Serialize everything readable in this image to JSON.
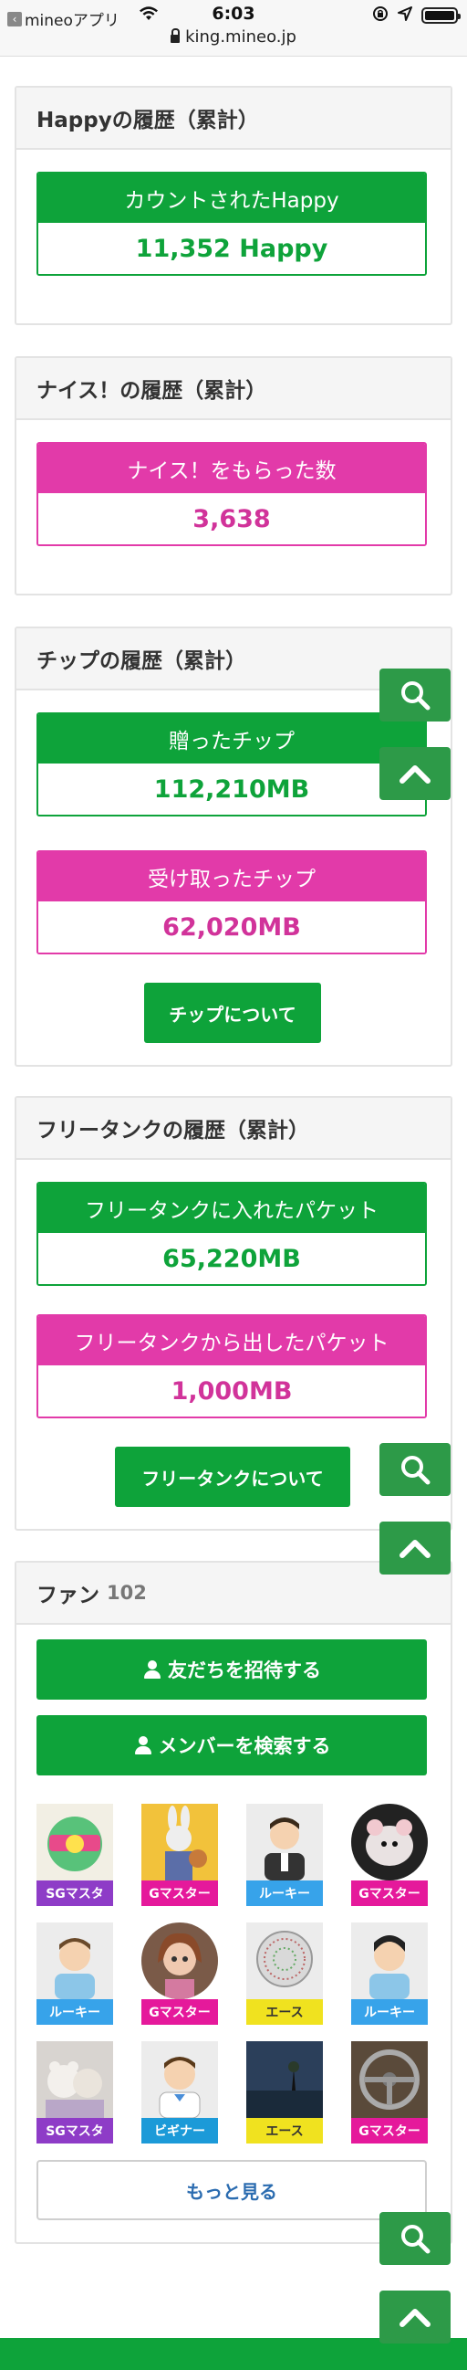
{
  "statusbar": {
    "back_app": "mineoアプリ",
    "time": "6:03",
    "url": "king.mineo.jp"
  },
  "happy": {
    "title": "Happyの履歴（累計）",
    "label": "カウントされたHappy",
    "value": "11,352 Happy"
  },
  "nice": {
    "title": "ナイス！の履歴（累計）",
    "label": "ナイス！をもらった数",
    "value": "3,638"
  },
  "tip": {
    "title": "チップの履歴（累計）",
    "sent_label": "贈ったチップ",
    "sent_value": "112,210MB",
    "received_label": "受け取ったチップ",
    "received_value": "62,020MB",
    "about_button": "チップについて"
  },
  "freetank": {
    "title": "フリータンクの履歴（累計）",
    "in_label": "フリータンクに入れたパケット",
    "in_value": "65,220MB",
    "out_label": "フリータンクから出したパケット",
    "out_value": "1,000MB",
    "about_button": "フリータンクについて"
  },
  "fans": {
    "title": "ファン",
    "count": "102",
    "invite_button": "友だちを招待する",
    "search_button": "メンバーを検索する",
    "more_button": "もっと見る",
    "items": [
      {
        "rank": "SGマスタ",
        "color": "#8e3cc7"
      },
      {
        "rank": "Gマスター",
        "color": "#e5199b"
      },
      {
        "rank": "ルーキー",
        "color": "#37a3ea"
      },
      {
        "rank": "Gマスター",
        "color": "#e5199b"
      },
      {
        "rank": "ルーキー",
        "color": "#37a3ea"
      },
      {
        "rank": "Gマスター",
        "color": "#e5199b"
      },
      {
        "rank": "エース",
        "color": "#f0e21f"
      },
      {
        "rank": "ルーキー",
        "color": "#37a3ea"
      },
      {
        "rank": "SGマスタ",
        "color": "#8e3cc7"
      },
      {
        "rank": "ビギナー",
        "color": "#1c9ad8"
      },
      {
        "rank": "エース",
        "color": "#f0e21f"
      },
      {
        "rank": "Gマスター",
        "color": "#e5199b"
      }
    ]
  },
  "floating": {
    "search_icon": "search-icon",
    "scroll_top_icon": "chevron-up-icon"
  },
  "colors": {
    "accent_green": "#0ea33a",
    "accent_pink": "#e23aa9",
    "fab_green": "#2d9a48"
  }
}
